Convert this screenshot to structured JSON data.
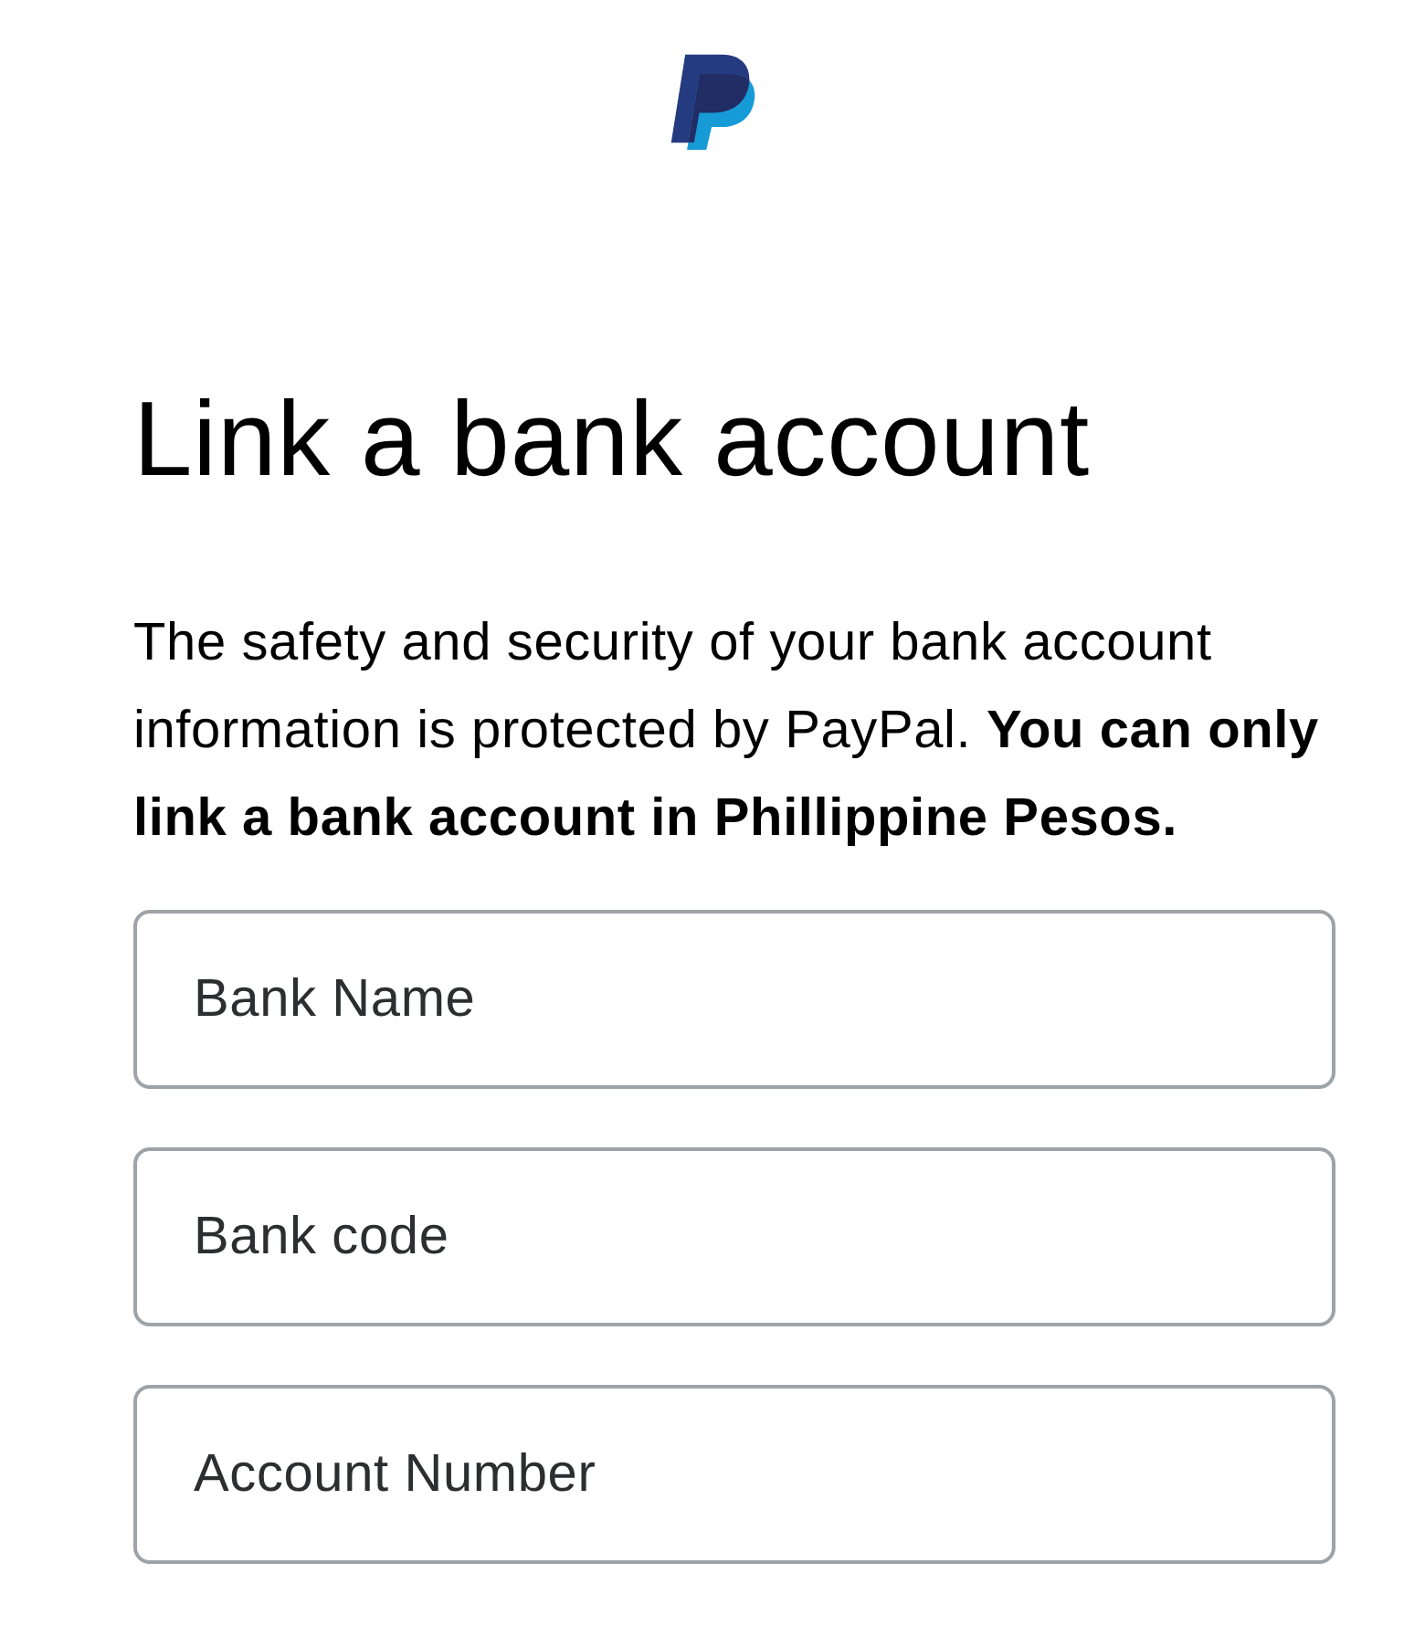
{
  "heading": "Link a bank account",
  "description": "The safety and security of your bank account information is protected by PayPal. **You can only link a bank account in Phillippine Pesos.**",
  "fields": [
    {
      "placeholder": "Bank Name"
    },
    {
      "placeholder": "Bank code"
    },
    {
      "placeholder": "Account Number"
    }
  ]
}
